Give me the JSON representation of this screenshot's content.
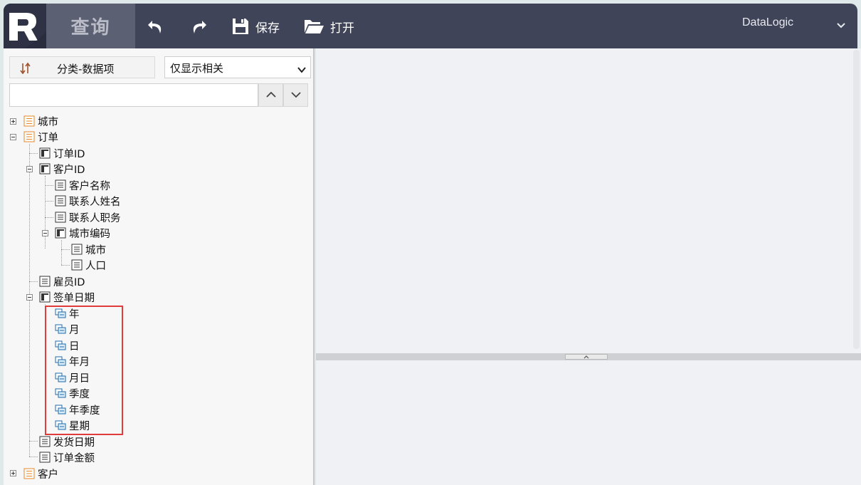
{
  "toolbar": {
    "logo_letter": "R",
    "query_tab": "查询",
    "undo": "undo-icon",
    "redo": "redo-icon",
    "save_label": "保存",
    "open_label": "打开",
    "user": "DataLogic"
  },
  "left": {
    "sort_label": "分类-数据项",
    "filter_selected": "仅显示相关",
    "search_value": ""
  },
  "tree": {
    "city": "城市",
    "order": "订单",
    "order_id": "订单ID",
    "customer_id": "客户ID",
    "customer_name": "客户名称",
    "contact_name": "联系人姓名",
    "contact_title": "联系人职务",
    "city_code": "城市编码",
    "city2": "城市",
    "population": "人口",
    "employee_id": "雇员ID",
    "sign_date": "签单日期",
    "year": "年",
    "month": "月",
    "day": "日",
    "year_month": "年月",
    "month_day": "月日",
    "quarter": "季度",
    "year_quarter": "年季度",
    "weekday": "星期",
    "ship_date": "发货日期",
    "order_amount": "订单金额",
    "customer": "客户"
  },
  "colors": {
    "topbar": "#3f4458",
    "highlight": "#e03c3c",
    "table_icon": "#e5892a",
    "date_icon": "#1f6aa8"
  }
}
